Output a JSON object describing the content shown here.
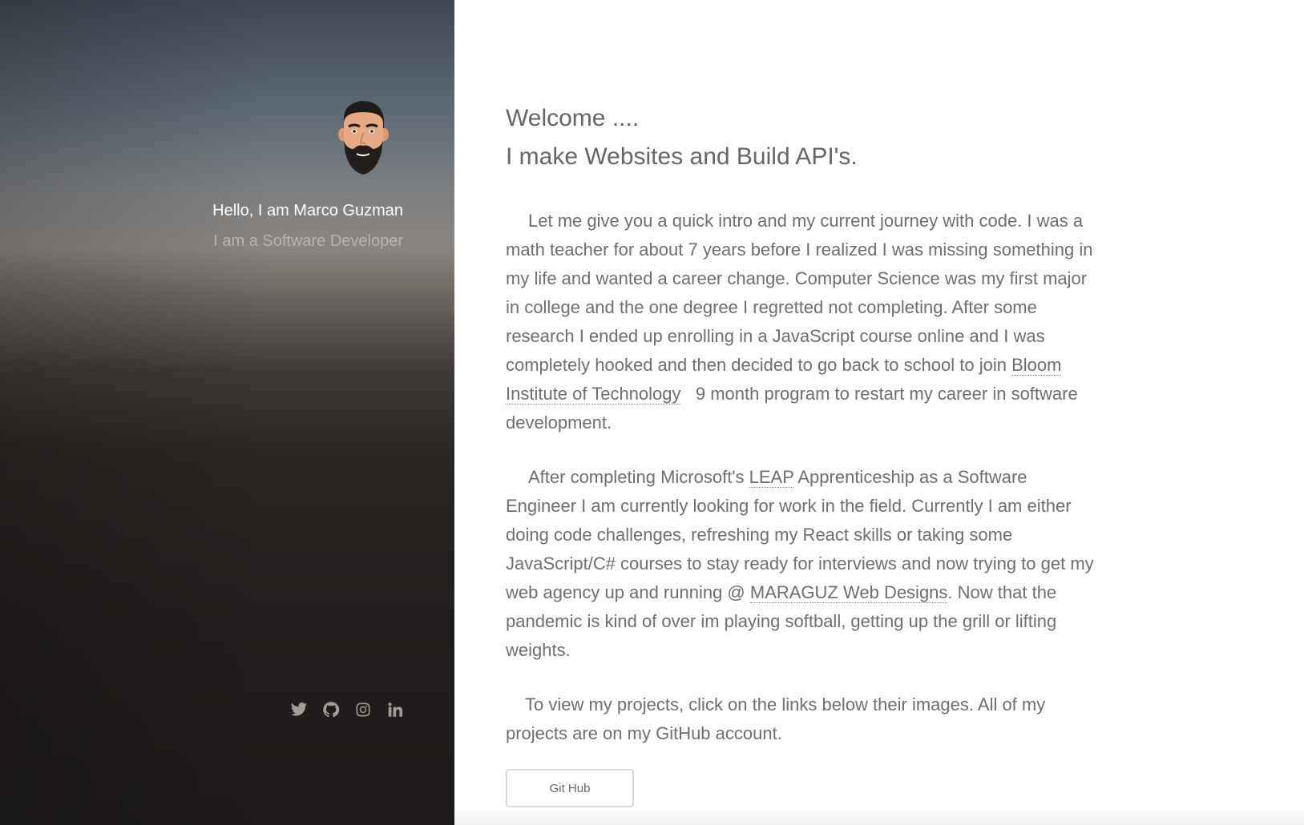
{
  "sidebar": {
    "greeting": "Hello, I am Marco Guzman",
    "role": "I am a Software Developer",
    "social": [
      {
        "icon": "twitter-icon"
      },
      {
        "icon": "github-icon"
      },
      {
        "icon": "instagram-icon"
      },
      {
        "icon": "linkedin-icon"
      }
    ]
  },
  "main": {
    "welcome": "Welcome ....",
    "tagline": "I make Websites and Build API's.",
    "p1": {
      "text_a": "Let me give you a quick intro and my current journey with code.   I was a math teacher for about 7 years before I realized I was missing something in my life and wanted a career change.   Computer Science was my first major in college and the one degree I regretted not completing.   After some research I ended up enrolling in a JavaScript course online and I was completely hooked and then decided to go back to school to join ",
      "link": "Bloom Institute of Technology",
      "text_b": "   9 month program to restart my career in software development."
    },
    "p2": {
      "text_a": "After completing Microsoft's ",
      "link1": "LEAP",
      "text_b": " Apprenticeship as a Software Engineer I am currently looking for work in the field.   Currently I am either doing code challenges, refreshing my React skills or taking some JavaScript/C# courses to stay ready for interviews and now trying to get my web agency up and running @ ",
      "link2": "MARAGUZ Web Designs",
      "text_c": ". Now that the pandemic is kind of over im playing softball, getting up the grill or lifting weights."
    },
    "p3": "To view my projects, click on the links below their images.   All of my projects are on my GitHub account.",
    "button": "Git Hub"
  },
  "colors": {
    "sidebar_top": "#3d4853",
    "sidebar_bottom": "#1d1a19",
    "text": "#6e6e6e"
  }
}
